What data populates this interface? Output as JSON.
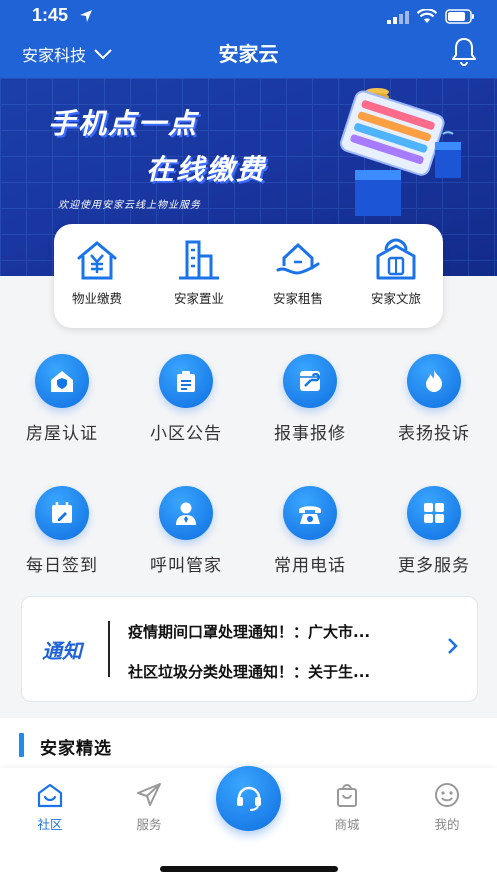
{
  "status_bar": {
    "time": "1:45"
  },
  "header": {
    "community": "安家科技",
    "title": "安家云"
  },
  "banner": {
    "headline_1": "手机点一点",
    "headline_2": "在线缴费",
    "subtitle": "欢迎使用安家云线上物业服务"
  },
  "quick_actions": [
    {
      "label": "物业缴费",
      "icon": "house-yuan-icon"
    },
    {
      "label": "安家置业",
      "icon": "buildings-icon"
    },
    {
      "label": "安家租售",
      "icon": "house-hand-icon"
    },
    {
      "label": "安家文旅",
      "icon": "luggage-icon"
    }
  ],
  "services": [
    {
      "label": "房屋认证",
      "icon": "house-shield-icon"
    },
    {
      "label": "小区公告",
      "icon": "notice-board-icon"
    },
    {
      "label": "报事报修",
      "icon": "repair-tools-icon"
    },
    {
      "label": "表扬投诉",
      "icon": "flame-icon"
    },
    {
      "label": "每日签到",
      "icon": "calendar-sign-icon"
    },
    {
      "label": "呼叫管家",
      "icon": "butler-icon"
    },
    {
      "label": "常用电话",
      "icon": "telephone-icon"
    },
    {
      "label": "更多服务",
      "icon": "grid-icon"
    }
  ],
  "notice": {
    "badge": "通知",
    "items": [
      "疫情期间口罩处理通知！：广大市...",
      "社区垃圾分类处理通知！：关于生..."
    ]
  },
  "section": {
    "title": "安家精选"
  },
  "tabbar": {
    "tabs": [
      {
        "label": "社区",
        "icon": "home-icon"
      },
      {
        "label": "服务",
        "icon": "paper-plane-icon"
      },
      {
        "label": "商城",
        "icon": "shopping-bag-icon"
      },
      {
        "label": "我的",
        "icon": "smiley-icon"
      }
    ],
    "center_icon": "headset-icon"
  },
  "colors": {
    "brand": "#1f63d6",
    "accent": "#1a73e8"
  }
}
